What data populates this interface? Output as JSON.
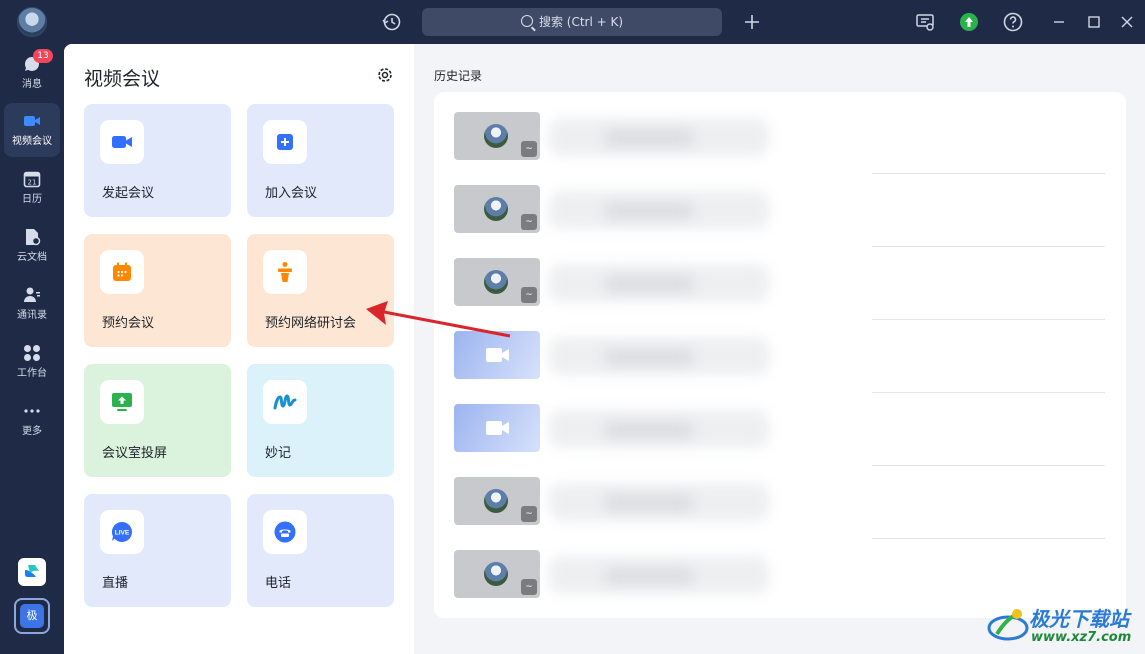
{
  "sidebar": {
    "items": [
      {
        "name": "messages",
        "label": "消息",
        "badge": "13"
      },
      {
        "name": "video-meeting",
        "label": "视频会议"
      },
      {
        "name": "calendar",
        "label": "日历",
        "icon_text": "21"
      },
      {
        "name": "cloud-docs",
        "label": "云文档"
      },
      {
        "name": "contacts",
        "label": "通讯录"
      },
      {
        "name": "workbench",
        "label": "工作台"
      },
      {
        "name": "more",
        "label": "更多"
      }
    ],
    "user_initial": "极"
  },
  "titlebar": {
    "search_placeholder": "搜索 (Ctrl + K)"
  },
  "panel": {
    "title": "视频会议",
    "tiles": [
      {
        "label": "发起会议",
        "color": "#e1e9fb",
        "icon": "video-camera-icon"
      },
      {
        "label": "加入会议",
        "color": "#e1e9fb",
        "icon": "plus-icon"
      },
      {
        "label": "预约会议",
        "color": "#fde6d4",
        "icon": "calendar-icon"
      },
      {
        "label": "预约网络研讨会",
        "color": "#fde6d4",
        "icon": "podium-icon"
      },
      {
        "label": "会议室投屏",
        "color": "#dbf2dc",
        "icon": "screen-share-icon"
      },
      {
        "label": "妙记",
        "color": "#dcf2fa",
        "icon": "minutes-icon"
      },
      {
        "label": "直播",
        "color": "#e1e9fb",
        "icon": "live-icon"
      },
      {
        "label": "电话",
        "color": "#e1e9fb",
        "icon": "phone-icon"
      }
    ],
    "live_icon_text": "LIVE"
  },
  "history": {
    "title": "历史记录",
    "rows": [
      {
        "thumb": "avatar"
      },
      {
        "thumb": "avatar"
      },
      {
        "thumb": "avatar"
      },
      {
        "thumb": "video"
      },
      {
        "thumb": "video"
      },
      {
        "thumb": "avatar"
      },
      {
        "thumb": "avatar"
      }
    ]
  },
  "watermark": {
    "text": "极光下载站",
    "url": "www.xz7.com"
  },
  "colors": {
    "accent": "#3370ff",
    "rail_bg": "#1e2a46",
    "arrow": "#d9262a",
    "upload_green": "#2bb24c"
  }
}
